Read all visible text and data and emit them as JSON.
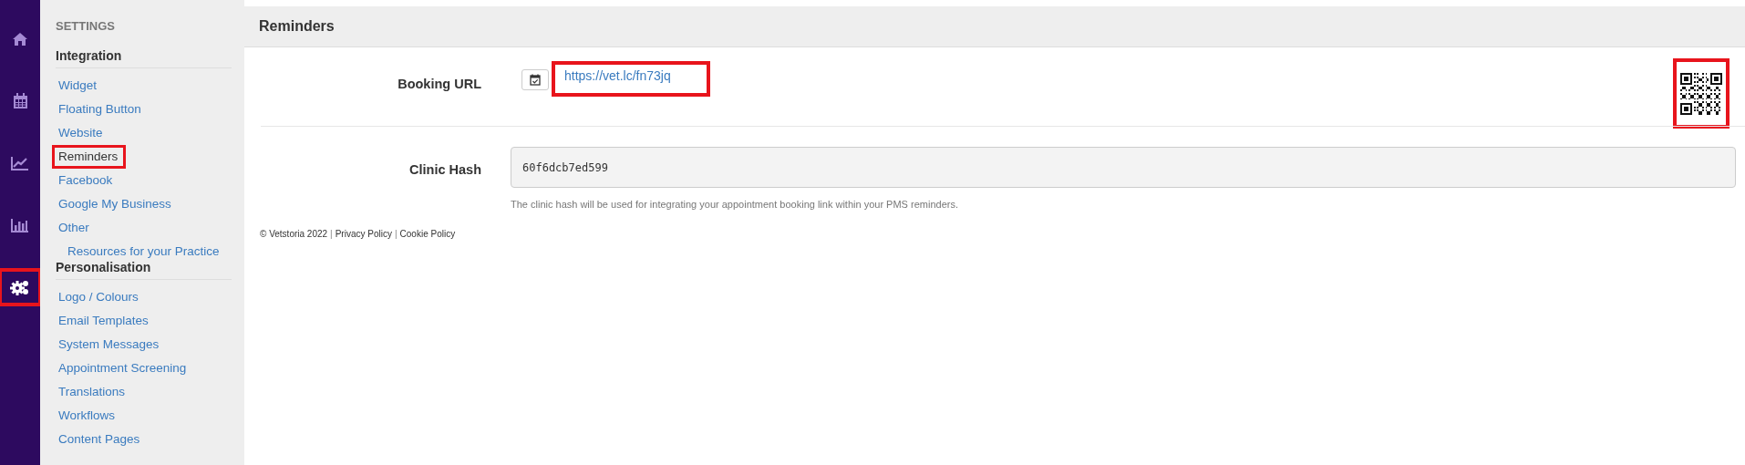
{
  "nav": [
    {
      "kind": "home",
      "selected": false,
      "highlighted": false
    },
    {
      "kind": "calendar",
      "selected": false,
      "highlighted": false
    },
    {
      "kind": "trend",
      "selected": false,
      "highlighted": false
    },
    {
      "kind": "bars",
      "selected": false,
      "highlighted": false
    },
    {
      "kind": "settings",
      "selected": true,
      "highlighted": true
    }
  ],
  "sidebar": {
    "title": "SETTINGS",
    "sections": [
      {
        "heading": "Integration",
        "items": [
          {
            "label": "Widget",
            "selected": false,
            "highlighted": false
          },
          {
            "label": "Floating Button",
            "selected": false,
            "highlighted": false
          },
          {
            "label": "Website",
            "selected": false,
            "highlighted": false
          },
          {
            "label": "Reminders",
            "selected": true,
            "highlighted": true
          },
          {
            "label": "Facebook",
            "selected": false,
            "highlighted": false
          },
          {
            "label": "Google My Business",
            "selected": false,
            "highlighted": false
          },
          {
            "label": "Other",
            "selected": false,
            "highlighted": false,
            "children": [
              {
                "label": "Resources for your Practice",
                "selected": false,
                "highlighted": false
              }
            ]
          }
        ]
      },
      {
        "heading": "Personalisation",
        "items": [
          {
            "label": "Logo / Colours",
            "selected": false,
            "highlighted": false
          },
          {
            "label": "Email Templates",
            "selected": false,
            "highlighted": false
          },
          {
            "label": "System Messages",
            "selected": false,
            "highlighted": false
          },
          {
            "label": "Appointment Screening",
            "selected": false,
            "highlighted": false
          },
          {
            "label": "Translations",
            "selected": false,
            "highlighted": false
          },
          {
            "label": "Workflows",
            "selected": false,
            "highlighted": false
          },
          {
            "label": "Content Pages",
            "selected": false,
            "highlighted": false
          }
        ]
      }
    ]
  },
  "page": {
    "title": "Reminders",
    "booking_url": {
      "label": "Booking URL",
      "url": "https://vet.lc/fn73jq",
      "highlighted": true,
      "qr_highlighted": true
    },
    "clinic_hash": {
      "label": "Clinic Hash",
      "value": "60f6dcb7ed599",
      "help": "The clinic hash will be used for integrating your appointment booking link within your PMS reminders."
    }
  },
  "footer": {
    "copyright": "© Vetstoria 2022",
    "separator_1": "|",
    "privacy": "Privacy Policy",
    "separator_2": "|",
    "cookie": "Cookie Policy"
  }
}
